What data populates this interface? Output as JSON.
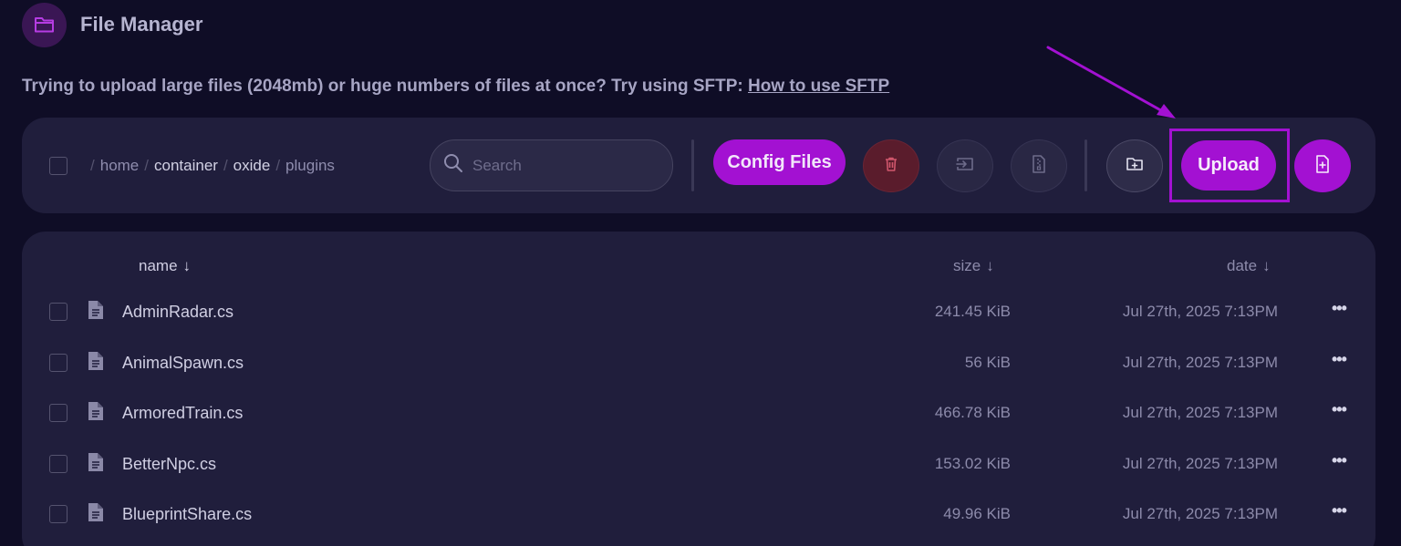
{
  "header": {
    "title": "File Manager",
    "icon": "folder-open-icon"
  },
  "notice": {
    "text": "Trying to upload large files (2048mb) or huge numbers of files at once? Try using SFTP: ",
    "link": "How to use SFTP"
  },
  "toolbar": {
    "breadcrumb": [
      "home",
      "container",
      "oxide",
      "plugins"
    ],
    "search_placeholder": "Search",
    "config_files_label": "Config Files",
    "upload_label": "Upload",
    "icons": {
      "delete": "trash-icon",
      "move": "move-icon",
      "archive": "archive-icon",
      "new_folder": "folder-plus-icon",
      "new_file": "file-plus-icon"
    }
  },
  "table": {
    "headers": {
      "name": "name",
      "size": "size",
      "date": "date"
    },
    "sort_arrow": "↓",
    "rows": [
      {
        "name": "AdminRadar.cs",
        "size": "241.45 KiB",
        "date": "Jul 27th, 2025 7:13PM"
      },
      {
        "name": "AnimalSpawn.cs",
        "size": "56 KiB",
        "date": "Jul 27th, 2025 7:13PM"
      },
      {
        "name": "ArmoredTrain.cs",
        "size": "466.78 KiB",
        "date": "Jul 27th, 2025 7:13PM"
      },
      {
        "name": "BetterNpc.cs",
        "size": "153.02 KiB",
        "date": "Jul 27th, 2025 7:13PM"
      },
      {
        "name": "BlueprintShare.cs",
        "size": "49.96 KiB",
        "date": "Jul 27th, 2025 7:13PM"
      }
    ],
    "more_label": "•••"
  },
  "colors": {
    "accent": "#a311d2",
    "background": "#0f0d26",
    "panel": "#201e3c",
    "danger": "#5a1c2c"
  }
}
